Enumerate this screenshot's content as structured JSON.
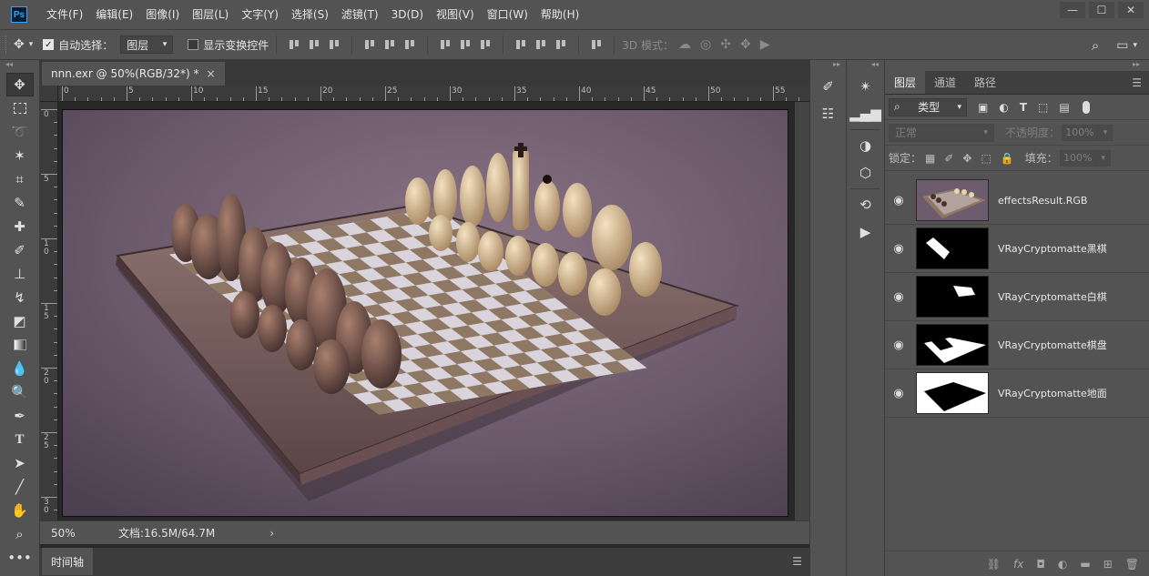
{
  "app": {
    "logo": "Ps"
  },
  "menu": [
    "文件(F)",
    "编辑(E)",
    "图像(I)",
    "图层(L)",
    "文字(Y)",
    "选择(S)",
    "滤镜(T)",
    "3D(D)",
    "视图(V)",
    "窗口(W)",
    "帮助(H)"
  ],
  "window_controls": [
    "—",
    "☐",
    "✕"
  ],
  "options": {
    "auto_select_label": "自动选择：",
    "auto_select_value": "图层",
    "show_transform_label": "显示变换控件",
    "mode3d_label": "3D 模式："
  },
  "document": {
    "tab_title": "nnn.exr @ 50%(RGB/32*) *",
    "zoom": "50%",
    "doc_info": "文档:16.5M/64.7M",
    "ruler_h": [
      "0",
      "5",
      "10",
      "15",
      "20",
      "25",
      "30",
      "35",
      "40",
      "45",
      "50",
      "55"
    ],
    "ruler_v": [
      "0",
      "5",
      "1\n0",
      "1\n5",
      "2\n0",
      "2\n5",
      "3\n0"
    ]
  },
  "timeline": {
    "label": "时间轴"
  },
  "layers_panel": {
    "tabs": [
      "图层",
      "通道",
      "路径"
    ],
    "filter_value": "类型",
    "blend_mode": "正常",
    "opacity_label": "不透明度：",
    "opacity_value": "100%",
    "lock_label": "锁定：",
    "fill_label": "填充：",
    "fill_value": "100%",
    "layers": [
      {
        "name": "effectsResult.RGB",
        "thumb": "render"
      },
      {
        "name": "VRayCryptomatte黑棋",
        "thumb": "black-pieces"
      },
      {
        "name": "VRayCryptomatte白棋",
        "thumb": "white-pieces"
      },
      {
        "name": "VRayCryptomatte棋盘",
        "thumb": "board"
      },
      {
        "name": "VRayCryptomatte地面",
        "thumb": "ground"
      }
    ]
  },
  "colors": {
    "ui_bg": "#535353",
    "canvas_bg": "#282828",
    "scene_tone": "#6d5c6d"
  }
}
